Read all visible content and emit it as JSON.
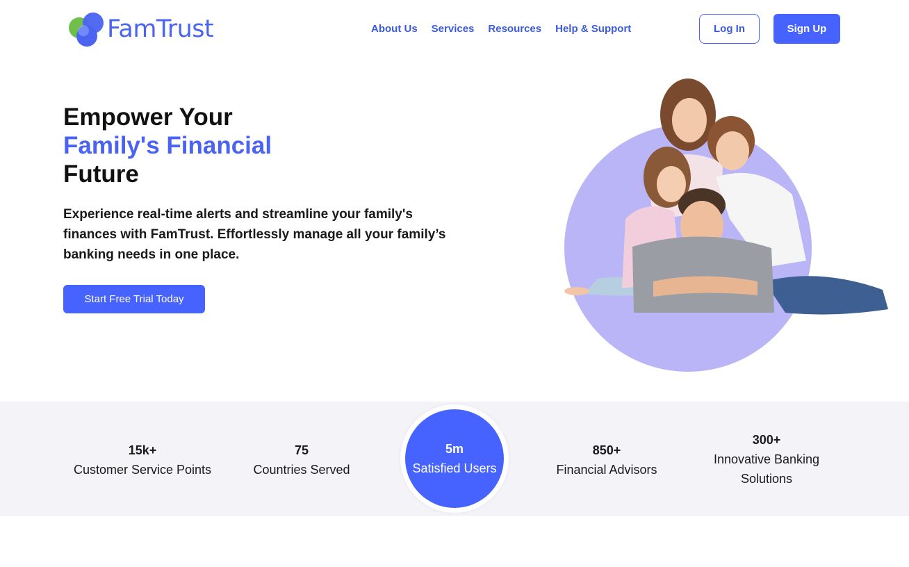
{
  "brand": {
    "name": "FamTrust",
    "accent": "#4763ff",
    "logo_icon": "overlapping-circles-logo-icon"
  },
  "nav": {
    "items": [
      "About Us",
      "Services",
      "Resources",
      "Help & Support"
    ]
  },
  "auth": {
    "login": "Log In",
    "signup": "Sign Up"
  },
  "hero": {
    "title_line1": "Empower Your",
    "title_line2": "Family's Financial",
    "title_line3": "Future",
    "subtitle": "Experience real-time alerts and streamline your family's finances with FamTrust. Effortlessly manage all your family’s banking needs in one place.",
    "cta": "Start Free Trial Today",
    "image": "family-photo"
  },
  "stats": [
    {
      "value": "15k+",
      "label": "Customer Service Points"
    },
    {
      "value": "75",
      "label": "Countries Served"
    },
    {
      "value": "5m",
      "label": "Satisfied Users",
      "highlighted": true
    },
    {
      "value": "850+",
      "label": "Financial Advisors"
    },
    {
      "value": "300+",
      "label": "Innovative Banking Solutions"
    }
  ]
}
